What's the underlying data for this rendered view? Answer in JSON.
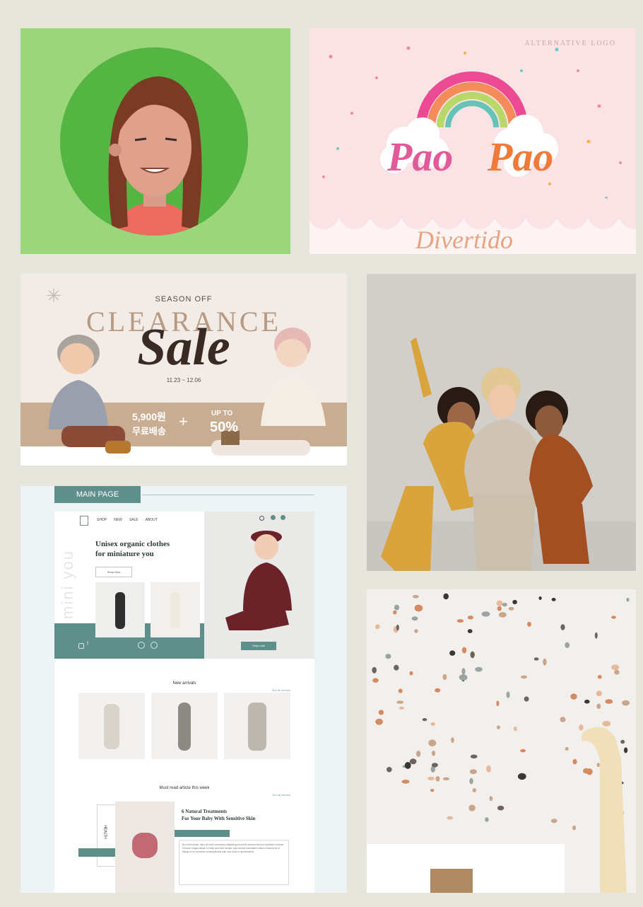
{
  "pao_pao": {
    "brand_label": "ALTERNATIVE LOGO",
    "logo_word_1": "Pao",
    "logo_word_2": "Pao",
    "script_text": "Divertido"
  },
  "clearance": {
    "season": "SEASON OFF",
    "headline": "CLEARANCE",
    "script": "Sale",
    "dates": "11.23 ~ 12.06",
    "promo_price": "5,900원",
    "promo_shipping": "무료배송",
    "plus": "+",
    "upto": "UP TO",
    "discount": "50%"
  },
  "site": {
    "tab_label": "MAIN PAGE",
    "vertical_brand": "mini you",
    "nav": [
      "SHOP",
      "NEW",
      "SALE",
      "ABOUT"
    ],
    "hero_title_1": "Unisex organic clothes",
    "hero_title_2": "for miniature you",
    "hero_button": "Shop Now",
    "hero_photo_button": "Shop now",
    "new_arrivals_title": "New arrivals",
    "new_arrivals_link": "See all arrivals",
    "article_section_title": "Must read article this week",
    "article_section_link": "See all articles",
    "article_side_label": "HEALTH",
    "article_title_1": "6 Natural Treatments",
    "article_title_2": "For Your Baby With Sensitive Skin",
    "article_body": "By Lorem Ipsum, dolor sit amet consectetur adipiscing elit sed do eiusmod tempor incididunt ut labore et dolore magna aliqua. Ut enim ad minim veniam, quis nostrud exercitation ullamco laboris nisi ut aliquip ex ea commodo consequat duis aute irure dolor in reprehenderit."
  },
  "colors": {
    "page_bg": "#e6e6dc",
    "teal": "#5f8f8a",
    "site_bg": "#eef4f5",
    "avatar_green": "#9bd67d",
    "avatar_circle": "#55b542",
    "pao_pink": "#fbe3e5"
  }
}
